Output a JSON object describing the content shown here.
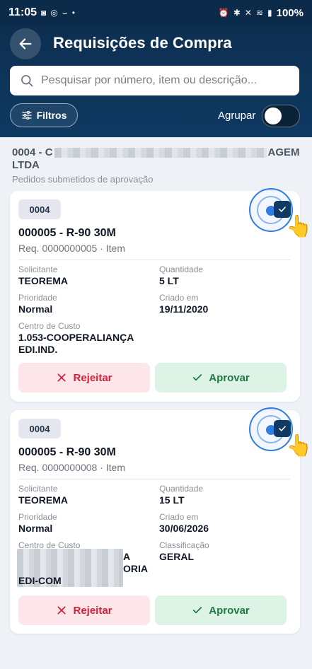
{
  "status_bar": {
    "time": "11:05",
    "battery": "100%"
  },
  "header": {
    "title": "Requisições de Compra",
    "search_placeholder": "Pesquisar por número, item ou descrição...",
    "filters_label": "Filtros",
    "group_label": "Agrupar",
    "group_enabled": false
  },
  "group": {
    "title_prefix": "0004 - C",
    "title_suffix": "AGEM",
    "title_line2": "LTDA",
    "subtitle": "Pedidos submetidos de aprovação"
  },
  "cards": [
    {
      "badge": "0004",
      "title": "000005 - R-90 30M",
      "subtitle": "Req. 0000000005 · Item",
      "selected": true,
      "fields": {
        "requester_label": "Solicitante",
        "requester_value": "TEOREMA",
        "quantity_label": "Quantidade",
        "quantity_value": "5 LT",
        "priority_label": "Prioridade",
        "priority_value": "Normal",
        "created_label": "Criado em",
        "created_value": "19/11/2020",
        "cost_center_label": "Centro de Custo",
        "cost_center_line1": "1.053-COOPERALIANÇA",
        "cost_center_line2": "EDI.IND."
      },
      "reject_label": "Rejeitar",
      "approve_label": "Aprovar"
    },
    {
      "badge": "0004",
      "title": "000005 - R-90 30M",
      "subtitle": "Req. 0000000008 · Item",
      "selected": true,
      "fields": {
        "requester_label": "Solicitante",
        "requester_value": "TEOREMA",
        "quantity_label": "Quantidade",
        "quantity_value": "15 LT",
        "priority_label": "Prioridade",
        "priority_value": "Normal",
        "created_label": "Criado em",
        "created_value": "30/06/2026",
        "cost_center_label": "Centro de Custo",
        "cost_center_line1": "A",
        "cost_center_line2": "ORIA",
        "cost_center_line3": "EDI-COM",
        "classification_label": "Classificação",
        "classification_value": "GERAL"
      },
      "reject_label": "Rejeitar",
      "approve_label": "Aprovar"
    }
  ],
  "colors": {
    "header": "#0f3a63",
    "accent": "#2f7de3",
    "reject": "#d11f3c",
    "approve": "#1f7a45"
  }
}
